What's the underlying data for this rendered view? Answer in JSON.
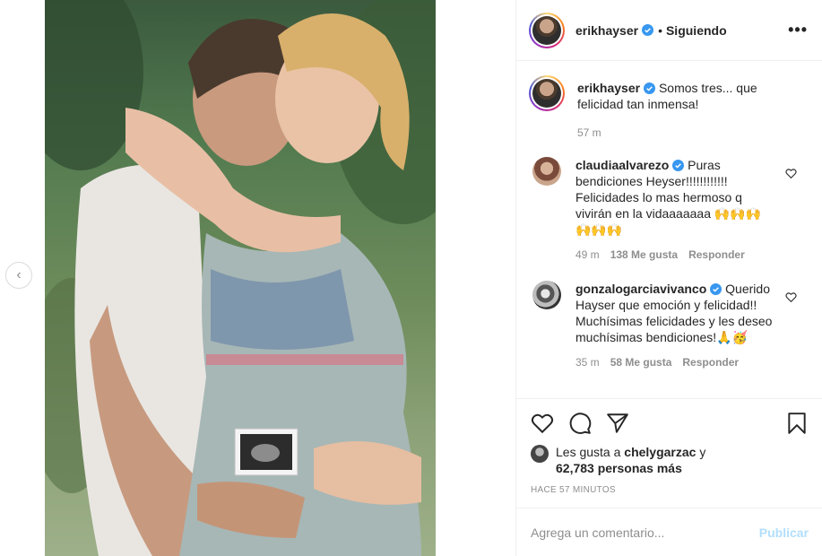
{
  "post": {
    "author": "erikhayser",
    "follow_state": "Siguiendo",
    "more_label": "•••",
    "dot": "•"
  },
  "caption": {
    "username": "erikhayser",
    "text": "Somos tres... que felicidad tan inmensa!",
    "time": "57 m"
  },
  "comments": [
    {
      "username": "claudiaalvarezo",
      "text": "Puras bendiciones Heyser!!!!!!!!!!!! Felicidades lo mas hermoso q vivirán en la vidaaaaaaa 🙌🙌🙌🙌🙌🙌",
      "time": "49 m",
      "likes": "138 Me gusta",
      "reply": "Responder"
    },
    {
      "username": "gonzalogarciavivanco",
      "text": "Querido Hayser que emoción y felicidad!! Muchísimas felicidades y les deseo muchísimas bendiciones!🙏🥳",
      "time": "35 m",
      "likes": "58 Me gusta",
      "reply": "Responder"
    }
  ],
  "likes": {
    "prefix": "Les gusta a",
    "user": "chelygarzac",
    "connector": "y",
    "others": "62,783 personas más"
  },
  "time_ago": "HACE 57 MINUTOS",
  "comment_box": {
    "placeholder": "Agrega un comentario...",
    "publish": "Publicar"
  },
  "nav": {
    "prev_arrow": "‹"
  },
  "colors": {
    "verified": "#3897f0",
    "publish": "#b2dffc",
    "muted": "#8e8e8e"
  }
}
